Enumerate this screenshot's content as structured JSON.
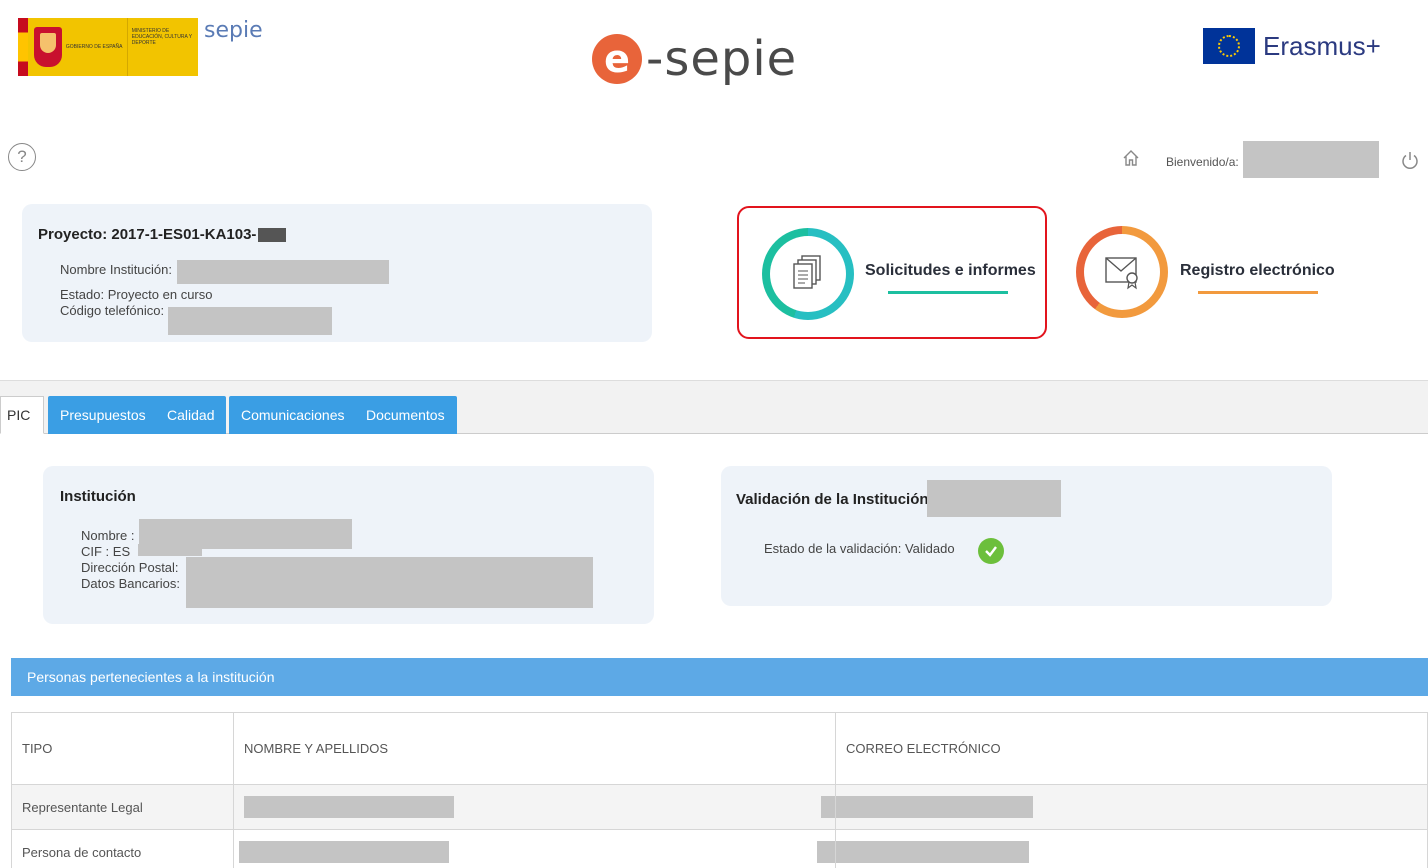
{
  "header": {
    "gov_text": "GOBIERNO DE ESPAÑA",
    "ministry_text": "MINISTERIO DE EDUCACIÓN, CULTURA Y DEPORTE",
    "sepie_small": "sepie",
    "center_logo_mark": "e",
    "center_logo_text": "-sepie",
    "eu_text": "Erasmus+"
  },
  "topbar": {
    "welcome_label": "Bienvenido/a:"
  },
  "project": {
    "title": "Proyecto: 2017-1-ES01-KA103-",
    "institution_label": "Nombre Institución:",
    "status_label": "Estado:",
    "status_value": "Proyecto en curso",
    "phone_label": "Código telefónico:"
  },
  "actions": {
    "solicitudes_label": "Solicitudes e informes",
    "registro_label": "Registro electrónico",
    "solicitudes_color": "#1cbfa0",
    "registro_color": "#f29a3e"
  },
  "tabs": [
    {
      "label": "PIC"
    },
    {
      "label": "Presupuestos"
    },
    {
      "label": "Calidad"
    },
    {
      "label": "Comunicaciones"
    },
    {
      "label": "Documentos"
    }
  ],
  "institution": {
    "title": "Institución",
    "name_label": "Nombre :",
    "cif_label": "CIF : ES",
    "address_label": "Dirección Postal:",
    "bank_label": "Datos Bancarios:"
  },
  "validation": {
    "title": "Validación de la Institución",
    "status_label": "Estado de la validación:",
    "status_value": "Validado"
  },
  "people": {
    "section_title": "Personas pertenecientes a la institución",
    "columns": [
      "TIPO",
      "NOMBRE Y APELLIDOS",
      "CORREO ELECTRÓNICO"
    ],
    "rows": [
      {
        "tipo": "Representante Legal"
      },
      {
        "tipo": "Persona de contacto"
      }
    ]
  },
  "icons": {
    "help": "help-icon",
    "home": "home-icon",
    "power": "power-icon",
    "documents": "documents-icon",
    "mail_certificate": "mail-certificate-icon",
    "check": "check-icon"
  }
}
